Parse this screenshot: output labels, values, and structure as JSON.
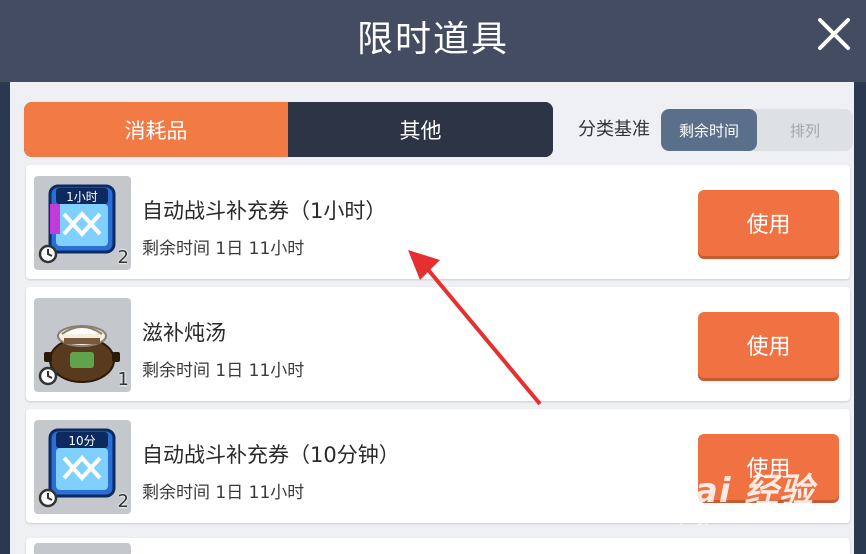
{
  "header": {
    "title": "限时道具"
  },
  "tabs": [
    {
      "label": "消耗品",
      "active": true
    },
    {
      "label": "其他",
      "active": false
    }
  ],
  "sort": {
    "label": "分类基准",
    "options": [
      {
        "label": "剩余时间",
        "active": true
      },
      {
        "label": "排列",
        "active": false
      }
    ]
  },
  "items": [
    {
      "name": "自动战斗补充券（1小时）",
      "time": "剩余时间 1日 11小时",
      "qty": "2",
      "badge": "1小时",
      "button": "使用",
      "icon": "ticket-icon"
    },
    {
      "name": "滋补炖汤",
      "time": "剩余时间 1日 11小时",
      "qty": "1",
      "button": "使用",
      "icon": "soup-pot-icon"
    },
    {
      "name": "自动战斗补充券（10分钟）",
      "time": "剩余时间 1日 11小时",
      "qty": "2",
      "badge": "10分",
      "button": "使用",
      "icon": "ticket-icon"
    }
  ],
  "watermark": {
    "text": "Bai 经验",
    "url": "jingyan.baidu.com"
  },
  "colors": {
    "accent": "#f27a44",
    "header": "#434c60",
    "tab_dark": "#2c3446",
    "sort_active": "#5a6f8a"
  }
}
